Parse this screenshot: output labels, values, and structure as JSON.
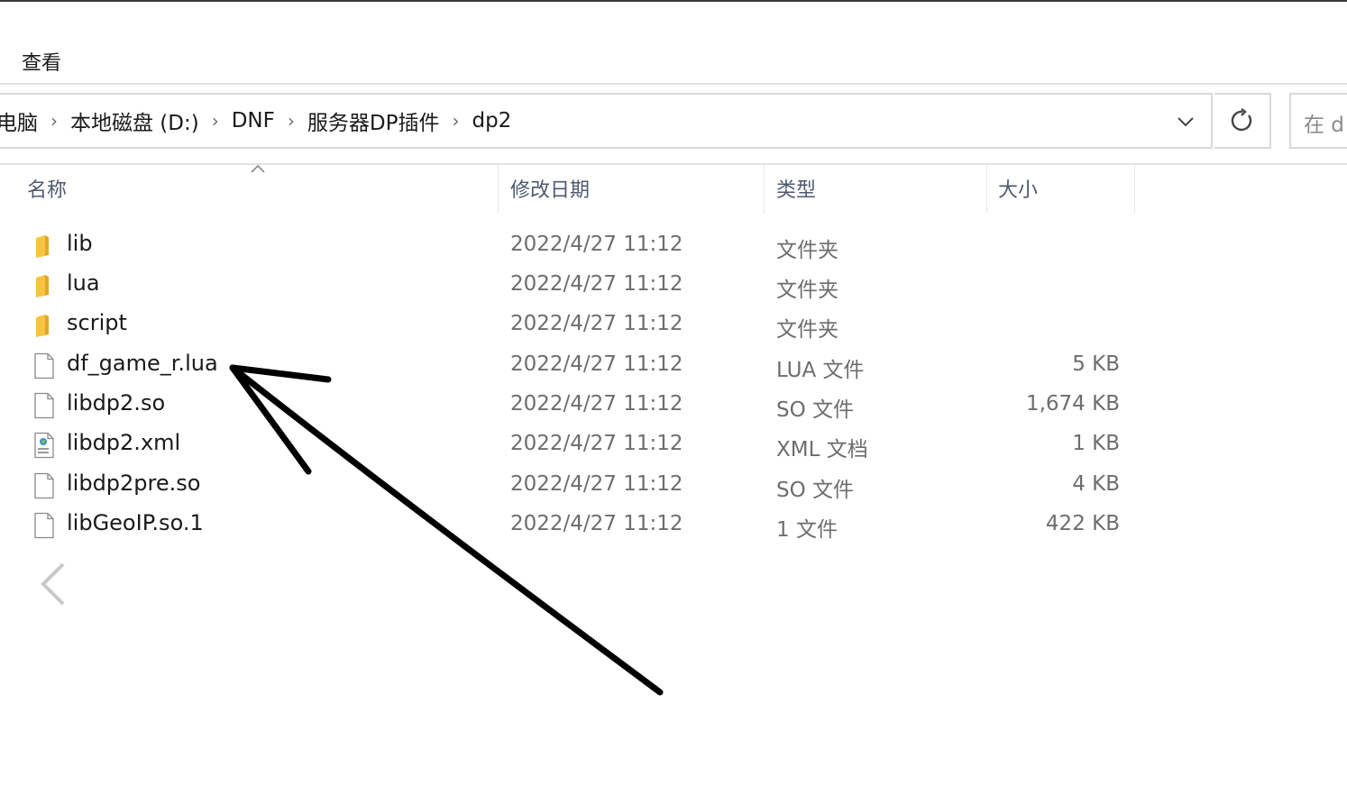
{
  "ribbon": {
    "view_tab": "查看"
  },
  "address": {
    "breadcrumbs": [
      "电脑",
      "本地磁盘 (D:)",
      "DNF",
      "服务器DP插件",
      "dp2"
    ],
    "separator": "›",
    "search_placeholder": "在 d"
  },
  "columns": {
    "name": "名称",
    "modified": "修改日期",
    "type": "类型",
    "size": "大小"
  },
  "files": [
    {
      "name": "lib",
      "modified": "2022/4/27 11:12",
      "type": "文件夹",
      "size": "",
      "icon": "folder-icon"
    },
    {
      "name": "lua",
      "modified": "2022/4/27 11:12",
      "type": "文件夹",
      "size": "",
      "icon": "folder-icon"
    },
    {
      "name": "script",
      "modified": "2022/4/27 11:12",
      "type": "文件夹",
      "size": "",
      "icon": "folder-icon"
    },
    {
      "name": "df_game_r.lua",
      "modified": "2022/4/27 11:12",
      "type": "LUA 文件",
      "size": "5 KB",
      "icon": "file-icon"
    },
    {
      "name": "libdp2.so",
      "modified": "2022/4/27 11:12",
      "type": "SO 文件",
      "size": "1,674 KB",
      "icon": "file-icon"
    },
    {
      "name": "libdp2.xml",
      "modified": "2022/4/27 11:12",
      "type": "XML 文档",
      "size": "1 KB",
      "icon": "xml-file-icon"
    },
    {
      "name": "libdp2pre.so",
      "modified": "2022/4/27 11:12",
      "type": "SO 文件",
      "size": "4 KB",
      "icon": "file-icon"
    },
    {
      "name": "libGeoIP.so.1",
      "modified": "2022/4/27 11:12",
      "type": "1 文件",
      "size": "422 KB",
      "icon": "file-icon"
    }
  ],
  "colors": {
    "folder": "#f6c440",
    "header_text": "#4d5a6e",
    "secondary_text": "#6d6d6d",
    "annotation_arrow": "#000000"
  }
}
